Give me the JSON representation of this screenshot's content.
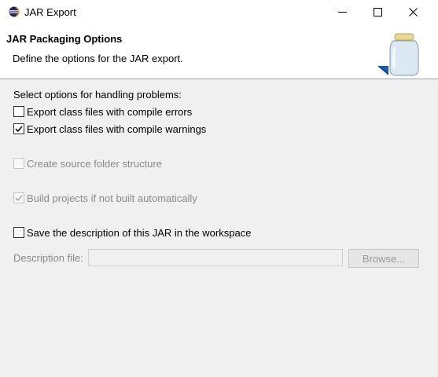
{
  "window": {
    "title": "JAR Export"
  },
  "banner": {
    "title": "JAR Packaging Options",
    "description": "Define the options for the JAR export."
  },
  "options": {
    "section_label": "Select options for handling problems:",
    "export_compile_errors": {
      "label": "Export class files with compile errors",
      "checked": false,
      "enabled": true
    },
    "export_compile_warnings": {
      "label": "Export class files with compile warnings",
      "checked": true,
      "enabled": true
    },
    "create_source_folder": {
      "label": "Create source folder structure",
      "checked": false,
      "enabled": false
    },
    "build_projects": {
      "label": "Build projects if not built automatically",
      "checked": true,
      "enabled": false
    },
    "save_description": {
      "label": "Save the description of this JAR in the workspace",
      "checked": false,
      "enabled": true
    }
  },
  "description_file": {
    "label": "Description file:",
    "value": "",
    "browse_label": "Browse..."
  },
  "colors": {
    "window_bg": "#f0f0f0",
    "banner_bg": "#ffffff",
    "disabled_text": "#8a8a8a",
    "eclipse_blue": "#2c2255"
  }
}
